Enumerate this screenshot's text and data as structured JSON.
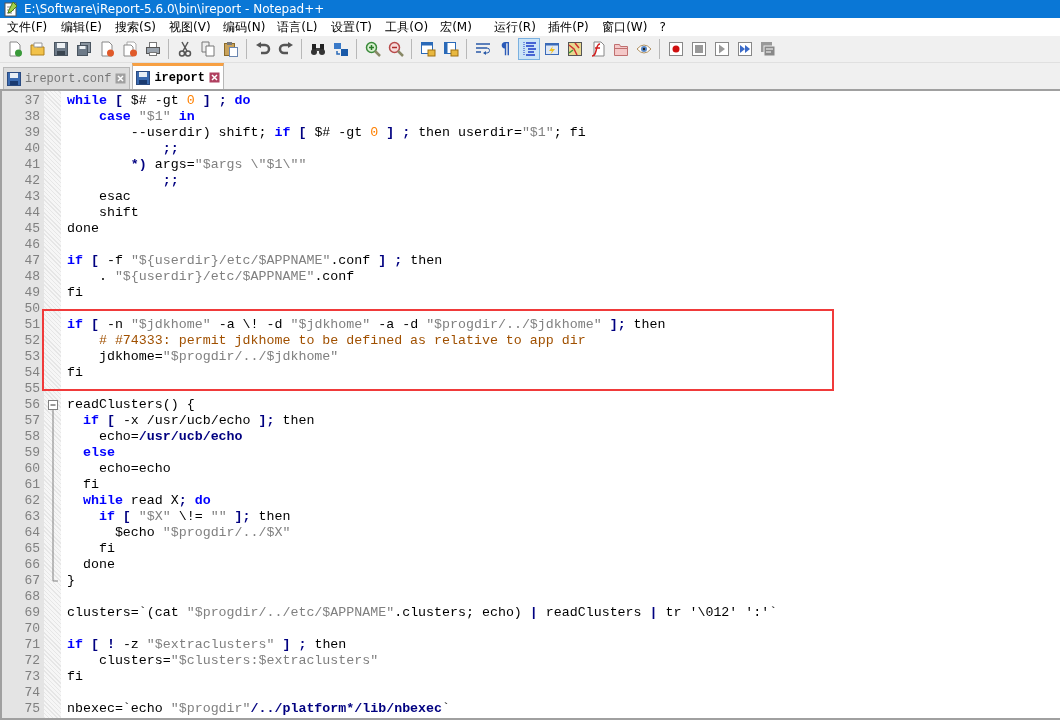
{
  "window": {
    "title": "E:\\Software\\iReport-5.6.0\\bin\\ireport - Notepad++"
  },
  "menu": [
    "文件(F)",
    "编辑(E)",
    "搜索(S)",
    "视图(V)",
    "编码(N)",
    "语言(L)",
    "设置(T)",
    "工具(O)",
    "宏(M)",
    "运行(R)",
    "插件(P)",
    "窗口(W)",
    "?"
  ],
  "toolbar": [
    [
      {
        "kind": "new-file",
        "selected": false
      },
      {
        "kind": "open-file",
        "selected": false
      },
      {
        "kind": "save",
        "selected": false
      },
      {
        "kind": "save-all",
        "selected": false
      },
      {
        "kind": "close-file",
        "selected": false
      },
      {
        "kind": "close-all",
        "selected": false
      },
      {
        "kind": "print",
        "selected": false
      }
    ],
    [
      {
        "kind": "cut",
        "selected": false
      },
      {
        "kind": "copy",
        "selected": false
      },
      {
        "kind": "paste",
        "selected": false
      }
    ],
    [
      {
        "kind": "undo",
        "selected": false
      },
      {
        "kind": "redo",
        "selected": false
      }
    ],
    [
      {
        "kind": "find",
        "selected": false
      },
      {
        "kind": "replace",
        "selected": false
      }
    ],
    [
      {
        "kind": "zoom-in",
        "selected": false
      },
      {
        "kind": "zoom-out",
        "selected": false
      }
    ],
    [
      {
        "kind": "sync-vertical",
        "selected": false
      },
      {
        "kind": "sync-horizontal",
        "selected": false
      }
    ],
    [
      {
        "kind": "word-wrap",
        "selected": false
      },
      {
        "kind": "glyph",
        "text": "¶",
        "selected": false
      },
      {
        "kind": "indent-guide",
        "selected": true
      },
      {
        "kind": "user-language",
        "selected": false
      },
      {
        "kind": "document-map",
        "selected": false
      },
      {
        "kind": "function-list",
        "selected": false
      },
      {
        "kind": "folder",
        "selected": false
      },
      {
        "kind": "eye",
        "selected": false
      }
    ],
    [
      {
        "kind": "record",
        "selected": false
      },
      {
        "kind": "stop",
        "selected": false
      },
      {
        "kind": "play",
        "selected": false
      },
      {
        "kind": "play-multiple",
        "selected": false
      },
      {
        "kind": "save-macro",
        "selected": false
      }
    ]
  ],
  "tabs": [
    {
      "label": "ireport.conf",
      "selected": false
    },
    {
      "label": "ireport",
      "selected": true
    }
  ],
  "lines": [
    {
      "number": "37",
      "kind": "plain",
      "boxed": false,
      "segments": [
        {
          "t": "while",
          "kind": "kw"
        },
        {
          "t": " [ ",
          "kind": "op"
        },
        {
          "t": "$# -gt ",
          "kind": "p"
        },
        {
          "t": "0",
          "kind": "num"
        },
        {
          "t": " ] ; ",
          "kind": "op"
        },
        {
          "t": "do",
          "kind": "kw"
        }
      ]
    },
    {
      "number": "38",
      "kind": "plain",
      "boxed": false,
      "segments": [
        {
          "t": "    case",
          "kind": "kw"
        },
        {
          "t": " \"$1\"",
          "kind": "str"
        },
        {
          "t": " in",
          "kind": "kw"
        }
      ]
    },
    {
      "number": "39",
      "kind": "plain",
      "boxed": false,
      "segments": [
        {
          "t": "        --userdir) shift; ",
          "kind": "p"
        },
        {
          "t": "if",
          "kind": "kw"
        },
        {
          "t": " [ ",
          "kind": "op"
        },
        {
          "t": "$# -gt ",
          "kind": "p"
        },
        {
          "t": "0",
          "kind": "num"
        },
        {
          "t": " ] ; ",
          "kind": "op"
        },
        {
          "t": "then userdir=",
          "kind": "p"
        },
        {
          "t": "\"$1\"",
          "kind": "str"
        },
        {
          "t": "; fi",
          "kind": "p"
        }
      ]
    },
    {
      "number": "40",
      "kind": "plain",
      "boxed": false,
      "segments": [
        {
          "t": "            ;;",
          "kind": "op"
        }
      ]
    },
    {
      "number": "41",
      "kind": "plain",
      "boxed": false,
      "segments": [
        {
          "t": "        *)",
          "kind": "op"
        },
        {
          "t": " args=",
          "kind": "p"
        },
        {
          "t": "\"$args \\\"$1\\\"\"",
          "kind": "str"
        }
      ]
    },
    {
      "number": "42",
      "kind": "plain",
      "boxed": false,
      "segments": [
        {
          "t": "            ;;",
          "kind": "op"
        }
      ]
    },
    {
      "number": "43",
      "kind": "plain",
      "boxed": false,
      "segments": [
        {
          "t": "    esac",
          "kind": "p"
        }
      ]
    },
    {
      "number": "44",
      "kind": "plain",
      "boxed": false,
      "segments": [
        {
          "t": "    shift",
          "kind": "p"
        }
      ]
    },
    {
      "number": "45",
      "kind": "plain",
      "boxed": false,
      "segments": [
        {
          "t": "done",
          "kind": "p"
        }
      ]
    },
    {
      "number": "46",
      "kind": "plain",
      "boxed": false
    },
    {
      "number": "47",
      "kind": "plain",
      "boxed": false,
      "segments": [
        {
          "t": "if",
          "kind": "kw"
        },
        {
          "t": " [ ",
          "kind": "op"
        },
        {
          "t": "-f ",
          "kind": "p"
        },
        {
          "t": "\"${userdir}/etc/$APPNAME\"",
          "kind": "str"
        },
        {
          "t": ".conf ",
          "kind": "p"
        },
        {
          "t": "] ; ",
          "kind": "op"
        },
        {
          "t": "then",
          "kind": "p"
        }
      ]
    },
    {
      "number": "48",
      "kind": "plain",
      "boxed": false,
      "segments": [
        {
          "t": "    . ",
          "kind": "p"
        },
        {
          "t": "\"${userdir}/etc/$APPNAME\"",
          "kind": "str"
        },
        {
          "t": ".conf",
          "kind": "p"
        }
      ]
    },
    {
      "number": "49",
      "kind": "plain",
      "boxed": false,
      "segments": [
        {
          "t": "fi",
          "kind": "p"
        }
      ]
    },
    {
      "number": "50",
      "kind": "plain",
      "boxed": false
    },
    {
      "number": "51",
      "kind": "plain",
      "boxed": true,
      "segments": [
        {
          "t": "if",
          "kind": "kw"
        },
        {
          "t": " [ ",
          "kind": "op"
        },
        {
          "t": "-n ",
          "kind": "p"
        },
        {
          "t": "\"$jdkhome\"",
          "kind": "str"
        },
        {
          "t": " -a \\! -d ",
          "kind": "p"
        },
        {
          "t": "\"$jdkhome\"",
          "kind": "str"
        },
        {
          "t": " -a -d ",
          "kind": "p"
        },
        {
          "t": "\"$progdir/../$jdkhome\"",
          "kind": "str"
        },
        {
          "t": " ]; ",
          "kind": "op"
        },
        {
          "t": "then",
          "kind": "p"
        }
      ]
    },
    {
      "number": "52",
      "kind": "plain",
      "boxed": true,
      "segments": [
        {
          "t": "    # #74333: permit jdkhome to be defined as relative to app dir",
          "kind": "cmt"
        }
      ]
    },
    {
      "number": "53",
      "kind": "plain",
      "boxed": true,
      "segments": [
        {
          "t": "    jdkhome=",
          "kind": "p"
        },
        {
          "t": "\"$progdir/../$jdkhome\"",
          "kind": "str"
        }
      ]
    },
    {
      "number": "54",
      "kind": "plain",
      "boxed": true,
      "segments": [
        {
          "t": "fi",
          "kind": "p"
        }
      ]
    },
    {
      "number": "55",
      "kind": "plain",
      "boxed": true
    },
    {
      "number": "56",
      "kind": "fold-start",
      "boxed": false,
      "segments": [
        {
          "t": "readClusters() {",
          "kind": "p"
        }
      ]
    },
    {
      "number": "57",
      "kind": "fold-body",
      "boxed": false,
      "segments": [
        {
          "t": "  if",
          "kind": "kw"
        },
        {
          "t": " [ ",
          "kind": "op"
        },
        {
          "t": "-x /usr/ucb/echo ",
          "kind": "p"
        },
        {
          "t": "]; ",
          "kind": "op"
        },
        {
          "t": "then",
          "kind": "p"
        }
      ]
    },
    {
      "number": "58",
      "kind": "fold-body",
      "boxed": false,
      "segments": [
        {
          "t": "    echo=",
          "kind": "p"
        },
        {
          "t": "/usr/ucb/echo",
          "kind": "op"
        }
      ]
    },
    {
      "number": "59",
      "kind": "fold-body",
      "boxed": false,
      "segments": [
        {
          "t": "  else",
          "kind": "kw"
        }
      ]
    },
    {
      "number": "60",
      "kind": "fold-body",
      "boxed": false,
      "segments": [
        {
          "t": "    echo=echo",
          "kind": "p"
        }
      ]
    },
    {
      "number": "61",
      "kind": "fold-body",
      "boxed": false,
      "segments": [
        {
          "t": "  fi",
          "kind": "p"
        }
      ]
    },
    {
      "number": "62",
      "kind": "fold-body",
      "boxed": false,
      "segments": [
        {
          "t": "  while",
          "kind": "kw"
        },
        {
          "t": " read X",
          "kind": "p"
        },
        {
          "t": "; ",
          "kind": "op"
        },
        {
          "t": "do",
          "kind": "kw"
        }
      ]
    },
    {
      "number": "63",
      "kind": "fold-body",
      "boxed": false,
      "segments": [
        {
          "t": "    if",
          "kind": "kw"
        },
        {
          "t": " [ ",
          "kind": "op"
        },
        {
          "t": "\"$X\"",
          "kind": "str"
        },
        {
          "t": " \\!= ",
          "kind": "p"
        },
        {
          "t": "\"\"",
          "kind": "str"
        },
        {
          "t": " ]; ",
          "kind": "op"
        },
        {
          "t": "then",
          "kind": "p"
        }
      ]
    },
    {
      "number": "64",
      "kind": "fold-body",
      "boxed": false,
      "segments": [
        {
          "t": "      $echo ",
          "kind": "p"
        },
        {
          "t": "\"$progdir/../$X\"",
          "kind": "str"
        }
      ]
    },
    {
      "number": "65",
      "kind": "fold-body",
      "boxed": false,
      "segments": [
        {
          "t": "    fi",
          "kind": "p"
        }
      ]
    },
    {
      "number": "66",
      "kind": "fold-body",
      "boxed": false,
      "segments": [
        {
          "t": "  done",
          "kind": "p"
        }
      ]
    },
    {
      "number": "67",
      "kind": "fold-end",
      "boxed": false,
      "segments": [
        {
          "t": "}",
          "kind": "p"
        }
      ]
    },
    {
      "number": "68",
      "kind": "plain",
      "boxed": false
    },
    {
      "number": "69",
      "kind": "plain",
      "boxed": false,
      "segments": [
        {
          "t": "clusters=`(cat ",
          "kind": "p"
        },
        {
          "t": "\"$progdir/../etc/$APPNAME\"",
          "kind": "str"
        },
        {
          "t": ".clusters; echo) ",
          "kind": "p"
        },
        {
          "t": "| ",
          "kind": "op"
        },
        {
          "t": "readClusters ",
          "kind": "p"
        },
        {
          "t": "| ",
          "kind": "op"
        },
        {
          "t": "tr '\\012' ':'`",
          "kind": "p"
        }
      ]
    },
    {
      "number": "70",
      "kind": "plain",
      "boxed": false
    },
    {
      "number": "71",
      "kind": "plain",
      "boxed": false,
      "segments": [
        {
          "t": "if",
          "kind": "kw"
        },
        {
          "t": " [ ! ",
          "kind": "op"
        },
        {
          "t": "-z ",
          "kind": "p"
        },
        {
          "t": "\"$extraclusters\"",
          "kind": "str"
        },
        {
          "t": " ] ; ",
          "kind": "op"
        },
        {
          "t": "then",
          "kind": "p"
        }
      ]
    },
    {
      "number": "72",
      "kind": "plain",
      "boxed": false,
      "segments": [
        {
          "t": "    clusters=",
          "kind": "p"
        },
        {
          "t": "\"$clusters:$extraclusters\"",
          "kind": "str"
        }
      ]
    },
    {
      "number": "73",
      "kind": "plain",
      "boxed": false,
      "segments": [
        {
          "t": "fi",
          "kind": "p"
        }
      ]
    },
    {
      "number": "74",
      "kind": "plain",
      "boxed": false
    },
    {
      "number": "75",
      "kind": "plain",
      "boxed": false,
      "segments": [
        {
          "t": "nbexec=`echo ",
          "kind": "p"
        },
        {
          "t": "\"$progdir\"",
          "kind": "str"
        },
        {
          "t": "/../platform*/lib/nbexec",
          "kind": "op"
        },
        {
          "t": "`",
          "kind": "p"
        }
      ]
    }
  ]
}
